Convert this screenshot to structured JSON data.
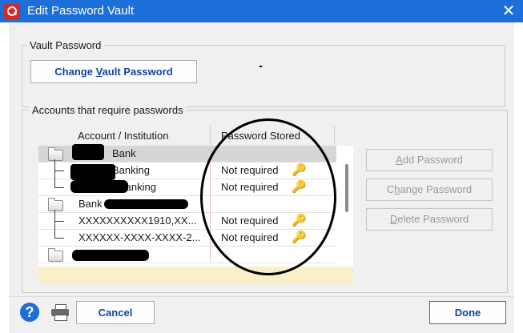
{
  "window": {
    "title": "Edit Password Vault",
    "close_glyph": "✕",
    "app_icon": "quicken-q-icon"
  },
  "vault_section": {
    "label": "Vault Password",
    "change_button": {
      "pre": "Change ",
      "accel": "V",
      "post": "ault Password"
    }
  },
  "accounts_section": {
    "label": "Accounts that require passwords",
    "columns": [
      "Account / Institution",
      "Password Stored"
    ],
    "rows": [
      {
        "type": "institution",
        "account": "Bank",
        "status": "",
        "selected": true
      },
      {
        "type": "account",
        "account": "Banking",
        "status": "Not required",
        "key": true
      },
      {
        "type": "account",
        "account": "Banking",
        "status": "Not required",
        "key": true
      },
      {
        "type": "institution",
        "account": "Bank",
        "status": "",
        "selected": false
      },
      {
        "type": "account",
        "account": "XXXXXXXXXX1910,XX...",
        "status": "Not required",
        "key": true
      },
      {
        "type": "account",
        "account": "XXXXXX-XXXX-XXXX-2...",
        "status": "Not required",
        "key": true
      },
      {
        "type": "institution",
        "account": "",
        "status": "",
        "selected": false
      }
    ]
  },
  "side_buttons": {
    "add": {
      "accel": "A",
      "rest": "dd Password"
    },
    "change": {
      "pre": "C",
      "accel": "h",
      "rest": "ange Password"
    },
    "delete": {
      "accel": "D",
      "rest": "elete Password"
    }
  },
  "footer": {
    "help_glyph": "?",
    "cancel_label": "Cancel",
    "done_label": "Done"
  },
  "icons": {
    "key": "🔑",
    "help": "help-icon",
    "printer": "printer-icon"
  },
  "colors": {
    "titlebar": "#1c6fd8",
    "accent_text": "#10469e",
    "footer_band": "#f9efc8"
  }
}
